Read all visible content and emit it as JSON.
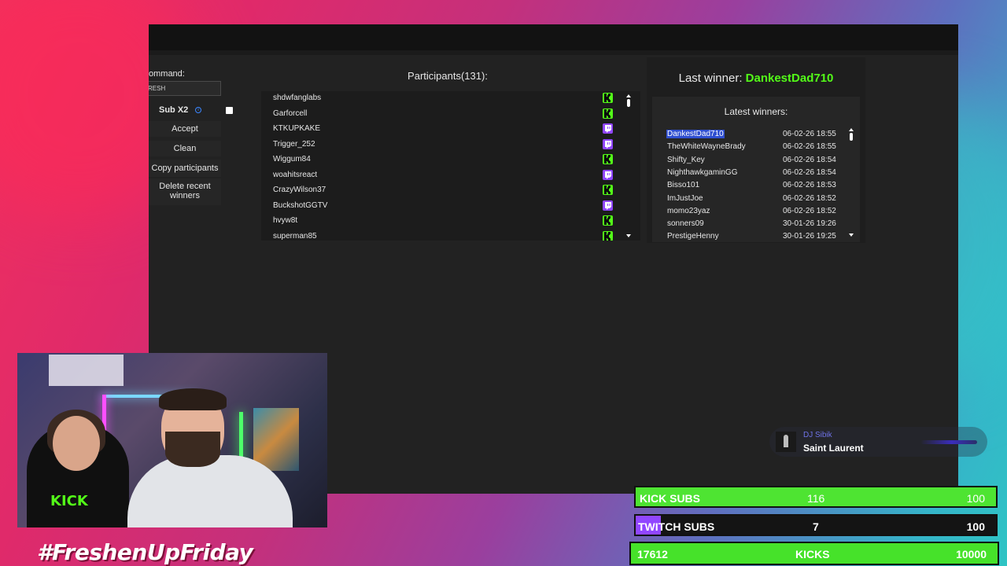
{
  "app": {
    "command_label": "ommand:",
    "command_value": "RESH",
    "sub_label": "Sub X2",
    "buttons": {
      "accept": "Accept",
      "clean": "Clean",
      "copy_participants": "Copy participants",
      "delete_recent_winners": "Delete recent winners"
    },
    "participants_title": "Participants(131):",
    "participants": [
      {
        "name": "shdwfanglabs",
        "platform": "kick"
      },
      {
        "name": "Garforcell",
        "platform": "kick"
      },
      {
        "name": "KTKUPKAKE",
        "platform": "twitch"
      },
      {
        "name": "Trigger_252",
        "platform": "twitch"
      },
      {
        "name": "Wiggum84",
        "platform": "kick"
      },
      {
        "name": "woahitsreact",
        "platform": "twitch"
      },
      {
        "name": "CrazyWilson37",
        "platform": "kick"
      },
      {
        "name": "BuckshotGGTV",
        "platform": "twitch"
      },
      {
        "name": "hvyw8t",
        "platform": "kick"
      },
      {
        "name": "superman85",
        "platform": "kick"
      }
    ],
    "last_winner_label": "Last winner:",
    "last_winner_name": "DankestDad710",
    "latest_winners_title": "Latest winners:",
    "latest_winners": [
      {
        "name": "DankestDad710",
        "time": "06-02-26 18:55",
        "selected": true
      },
      {
        "name": "TheWhiteWayneBrady",
        "time": "06-02-26 18:55"
      },
      {
        "name": "Shifty_Key",
        "time": "06-02-26 18:54"
      },
      {
        "name": "NighthawkgaminGG",
        "time": "06-02-26 18:54"
      },
      {
        "name": "Bisso101",
        "time": "06-02-26 18:53"
      },
      {
        "name": "ImJustJoe",
        "time": "06-02-26 18:52"
      },
      {
        "name": "momo23yaz",
        "time": "06-02-26 18:52"
      },
      {
        "name": "sonners09",
        "time": "30-01-26 19:26"
      },
      {
        "name": "PrestigeHenny",
        "time": "30-01-26 19:25"
      }
    ]
  },
  "webcam": {
    "shirt_text": "KICK"
  },
  "hashtag": "#FreshenUpFriday",
  "now_playing": {
    "artist": "DJ Sibik",
    "title": "Saint Laurent",
    "progress": 0.55
  },
  "goals": {
    "kick_subs": {
      "label": "KICK SUBS",
      "current": "116",
      "target": "100",
      "fill": 1.0
    },
    "twitch_subs": {
      "label": "TWITCH SUBS",
      "current": "7",
      "target": "100",
      "fill": 0.07
    },
    "kicks": {
      "current": "17612",
      "label": "KICKS",
      "target": "10000"
    }
  },
  "colors": {
    "kick": "#53fc18",
    "twitch": "#9146ff",
    "selection": "#2f4fd0"
  }
}
